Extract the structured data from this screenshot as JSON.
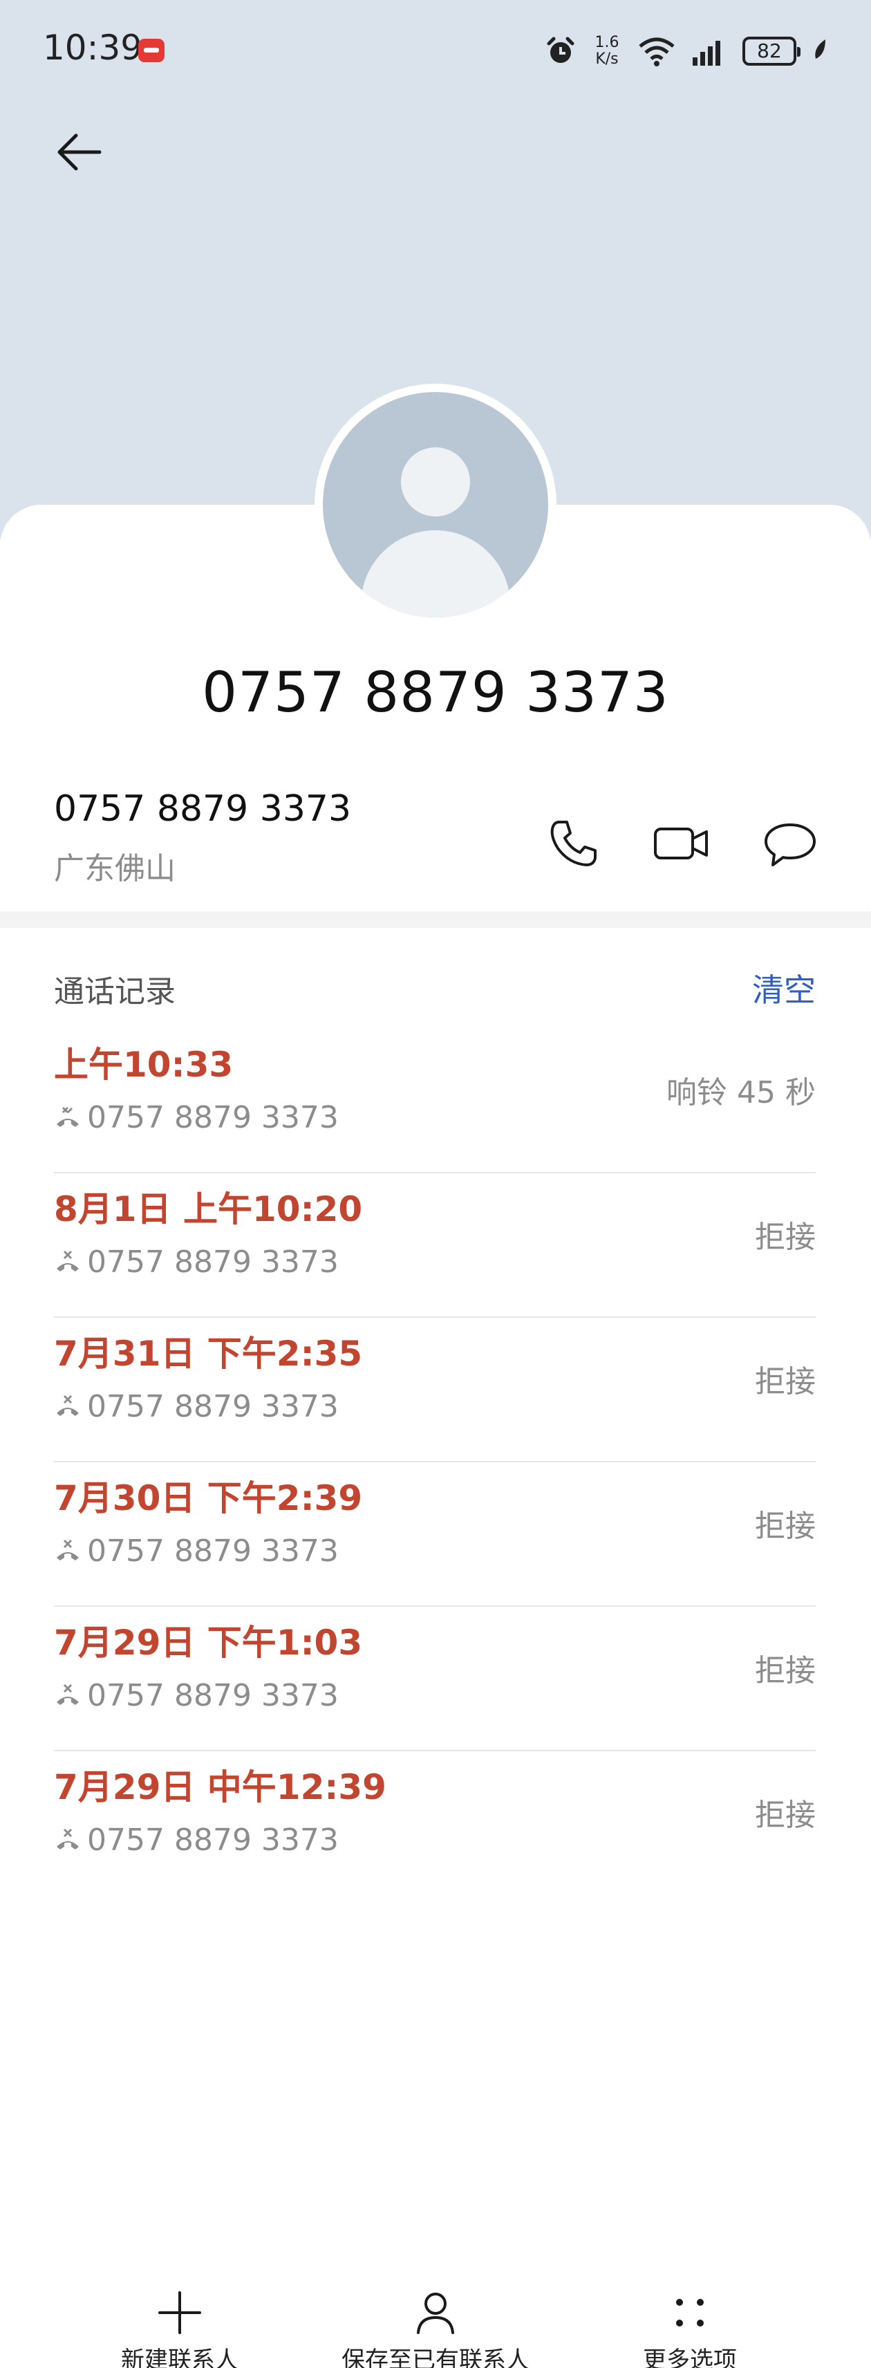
{
  "status_bar": {
    "time": "10:39",
    "speed": "1.6 K/s",
    "battery": "82"
  },
  "contact": {
    "title": "0757 8879 3373",
    "number": "0757 8879 3373",
    "location": "广东佛山"
  },
  "actions": {
    "call_icon": "phone-icon",
    "video_icon": "video-camera-icon",
    "message_icon": "message-bubble-icon"
  },
  "call_log": {
    "title": "通话记录",
    "clear_label": "清空",
    "accent_color": "#c1452f",
    "items": [
      {
        "time": "上午10:33",
        "number": "0757 8879 3373",
        "status": "响铃 45 秒"
      },
      {
        "time": "8月1日 上午10:20",
        "number": "0757 8879 3373",
        "status": "拒接"
      },
      {
        "time": "7月31日 下午2:35",
        "number": "0757 8879 3373",
        "status": "拒接"
      },
      {
        "time": "7月30日 下午2:39",
        "number": "0757 8879 3373",
        "status": "拒接"
      },
      {
        "time": "7月29日 下午1:03",
        "number": "0757 8879 3373",
        "status": "拒接"
      },
      {
        "time": "7月29日 中午12:39",
        "number": "0757 8879 3373",
        "status": "拒接"
      }
    ]
  },
  "bottom_bar": {
    "new_contact": "新建联系人",
    "save_existing": "保存至已有联系人",
    "more_options": "更多选项"
  }
}
